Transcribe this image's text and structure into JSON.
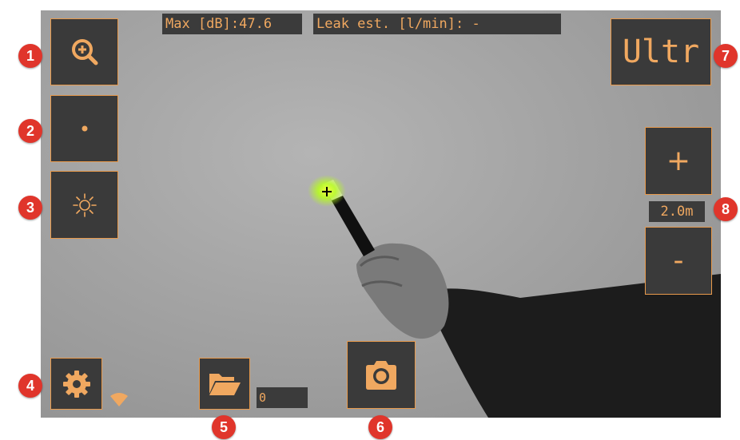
{
  "readout": {
    "max_db": "Max [dB]:47.6",
    "leak_est": "Leak est. [l/min]: -"
  },
  "mode_button": {
    "label": "Ultr"
  },
  "distance": {
    "plus_label": "+",
    "minus_label": "-",
    "value": "2.0m"
  },
  "capture": {
    "counter": "0"
  },
  "callouts": [
    "1",
    "2",
    "3",
    "4",
    "5",
    "6",
    "7",
    "8"
  ],
  "icons": {
    "zoom": "zoom-in-icon",
    "focus": "dot-icon",
    "brightness": "sun-icon",
    "settings": "gear-icon",
    "wifi": "wifi-icon",
    "folder": "folder-open-icon",
    "camera": "camera-icon"
  },
  "colors": {
    "accent": "#f0a860",
    "button_bg": "#3a3a3a",
    "callout": "#e0352b",
    "hotspot": "#b8ff1a"
  }
}
